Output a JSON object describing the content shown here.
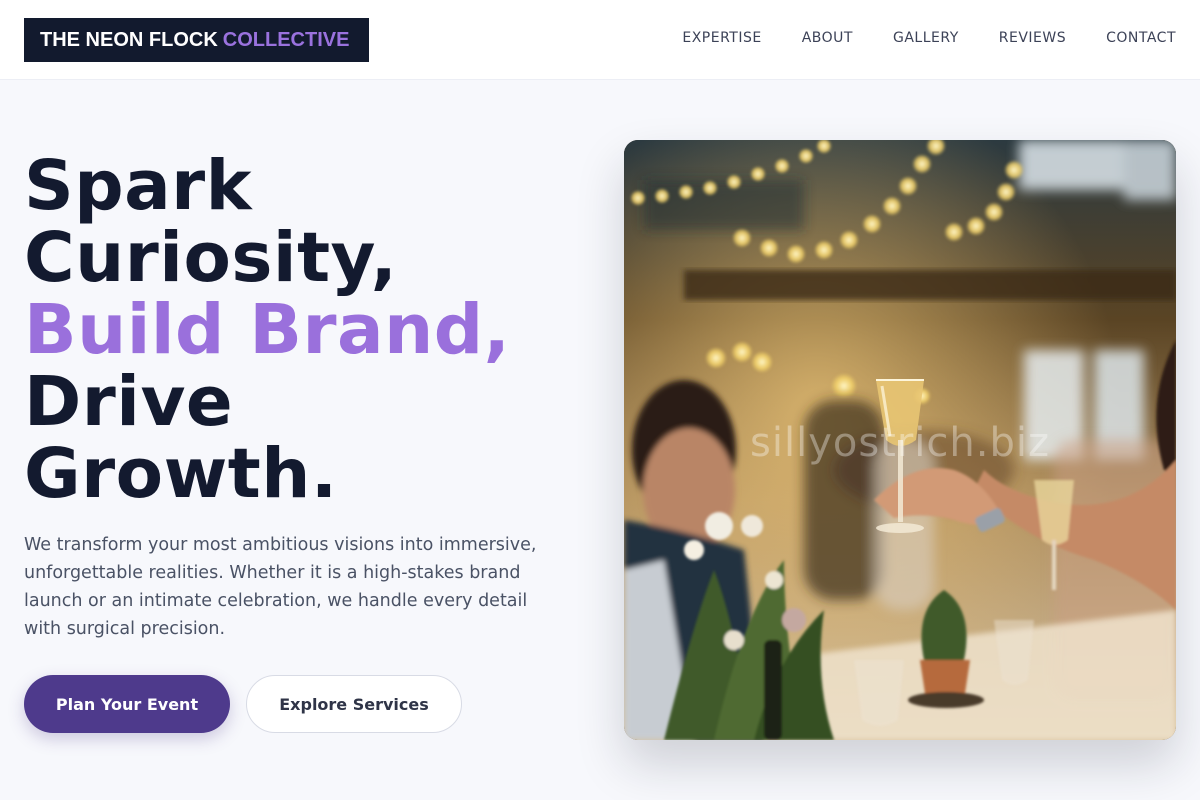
{
  "header": {
    "logo_main": "THE NEON FLOCK",
    "logo_accent": "COLLECTIVE",
    "nav": [
      {
        "label": "EXPERTISE"
      },
      {
        "label": "ABOUT"
      },
      {
        "label": "GALLERY"
      },
      {
        "label": "REVIEWS"
      },
      {
        "label": "CONTACT"
      }
    ]
  },
  "hero": {
    "title_lines": [
      "Spark",
      "Curiosity,",
      "Build Brand,",
      "Drive",
      "Growth."
    ],
    "accent_line_index": 2,
    "description": "We transform your most ambitious visions into immersive, unforgettable realities. Whether it is a high-stakes brand launch or an intimate celebration, we handle every detail with surgical precision.",
    "primary_button": "Plan Your Event",
    "secondary_button": "Explore Services",
    "image": {
      "watermark": "sillyostrich.biz"
    }
  },
  "colors": {
    "accent": "#9a70dc",
    "primary_button": "#4e3a8c",
    "heading": "#131a2f",
    "logo_bg": "#121a2e"
  }
}
